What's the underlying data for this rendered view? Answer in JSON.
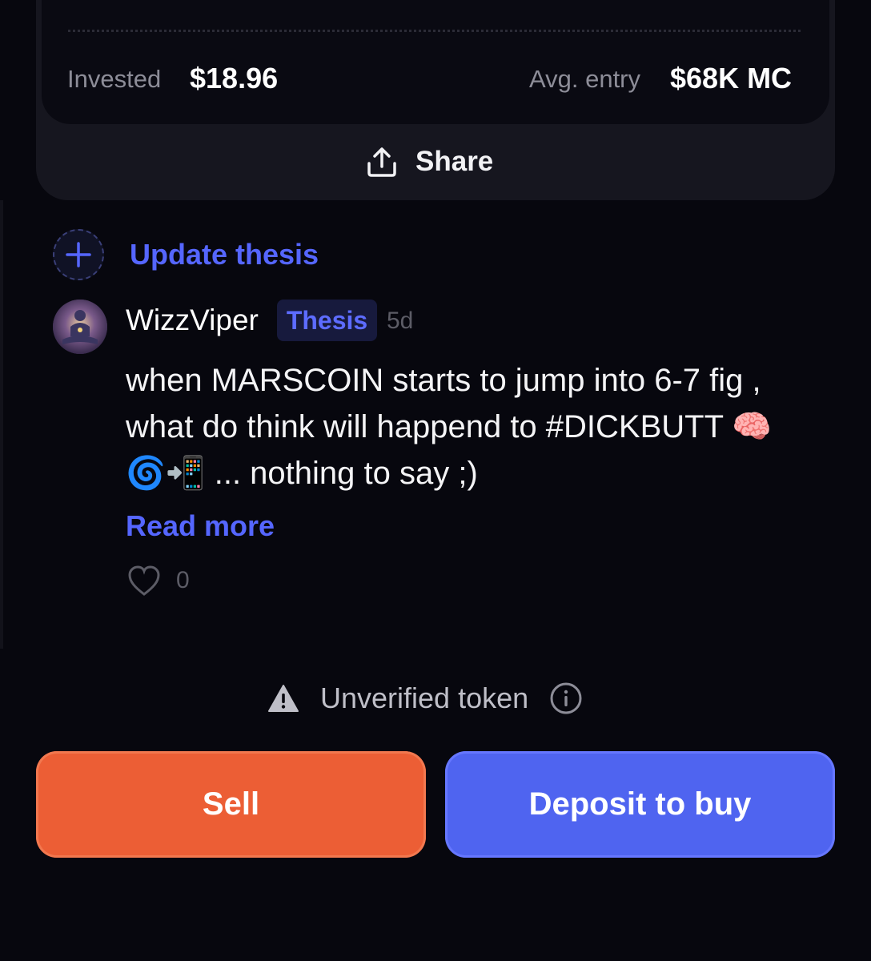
{
  "position": {
    "invested_label": "Invested",
    "invested_value": "$18.96",
    "avg_entry_label": "Avg. entry",
    "avg_entry_value": "$68K MC",
    "share_label": "Share"
  },
  "thesis": {
    "update_label": "Update thesis"
  },
  "post": {
    "author": "WizzViper",
    "badge": "Thesis",
    "time": "5d",
    "body": "when MARSCOIN starts to jump into 6-7 fig , what do think will happend to #DICKBUTT 🧠🌀📲 ... nothing to say ;)",
    "read_more": "Read more",
    "likes": "0"
  },
  "footer": {
    "warning": "Unverified token",
    "sell_label": "Sell",
    "buy_label": "Deposit to buy"
  },
  "colors": {
    "accent": "#5566ff",
    "sell": "#ec5e35",
    "buy": "#4f64f0",
    "background": "#07070e"
  }
}
